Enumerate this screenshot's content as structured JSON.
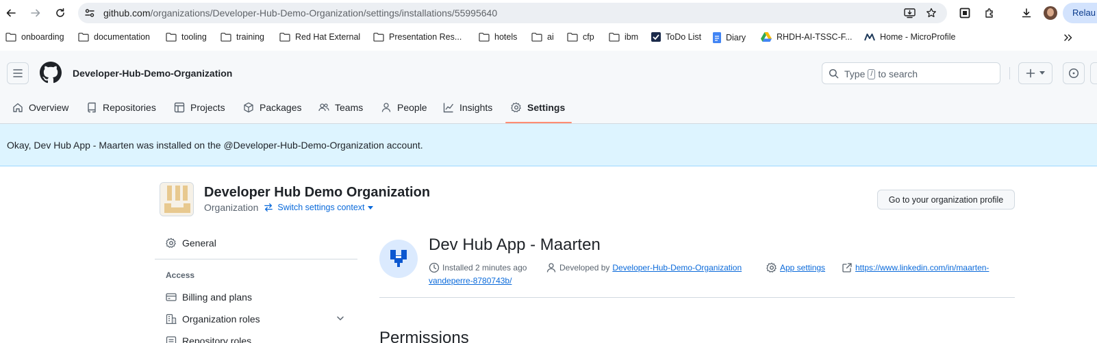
{
  "browser": {
    "url_host": "github.com",
    "url_path": "/organizations/Developer-Hub-Demo-Organization/settings/installations/55995640",
    "relaunch_label": "Relau",
    "bookmarks": [
      {
        "label": "onboarding",
        "icon": "folder-icon"
      },
      {
        "label": "documentation",
        "icon": "folder-icon"
      },
      {
        "label": "tooling",
        "icon": "folder-icon"
      },
      {
        "label": "training",
        "icon": "folder-icon"
      },
      {
        "label": "Red Hat External",
        "icon": "folder-icon"
      },
      {
        "label": "Presentation Res...",
        "icon": "folder-icon"
      },
      {
        "label": "hotels",
        "icon": "folder-icon"
      },
      {
        "label": "ai",
        "icon": "folder-icon"
      },
      {
        "label": "cfp",
        "icon": "folder-icon"
      },
      {
        "label": "ibm",
        "icon": "folder-icon"
      },
      {
        "label": "ToDo List",
        "icon": "todo-icon"
      },
      {
        "label": "Diary",
        "icon": "docs-icon"
      },
      {
        "label": "RHDH-AI-TSSC-F...",
        "icon": "drive-icon"
      },
      {
        "label": "Home - MicroProfile",
        "icon": "microprofile-icon"
      }
    ]
  },
  "header": {
    "org_name": "Developer-Hub-Demo-Organization",
    "search_prefix": "Type",
    "search_key": "/",
    "search_suffix": "to search"
  },
  "tabs": [
    {
      "label": "Overview",
      "icon": "home-icon"
    },
    {
      "label": "Repositories",
      "icon": "repo-icon"
    },
    {
      "label": "Projects",
      "icon": "table-icon"
    },
    {
      "label": "Packages",
      "icon": "package-icon"
    },
    {
      "label": "Teams",
      "icon": "people-icon"
    },
    {
      "label": "People",
      "icon": "person-icon"
    },
    {
      "label": "Insights",
      "icon": "graph-icon"
    },
    {
      "label": "Settings",
      "icon": "gear-icon",
      "active": true
    }
  ],
  "flash": {
    "message": "Okay, Dev Hub App - Maarten was installed on the @Developer-Hub-Demo-Organization account."
  },
  "org_context": {
    "title": "Developer Hub Demo Organization",
    "type": "Organization",
    "switch_label": "Switch settings context",
    "profile_button": "Go to your organization profile"
  },
  "sidebar": {
    "general": "General",
    "access_heading": "Access",
    "items": [
      "Billing and plans",
      "Organization roles",
      "Repository roles"
    ]
  },
  "app": {
    "name": "Dev Hub App - Maarten",
    "installed": "Installed 2 minutes ago",
    "developed_by_prefix": "Developed by",
    "developer": "Developer-Hub-Demo-Organization",
    "app_settings": "App settings",
    "homepage_line1": "https://www.linkedin.com/in/maarten-",
    "homepage_line2": "vandeperre-8780743b/",
    "permissions_heading": "Permissions"
  },
  "colors": {
    "link": "#0969da",
    "flash_bg": "#ddf4ff",
    "tab_underline": "#fd8c73"
  }
}
